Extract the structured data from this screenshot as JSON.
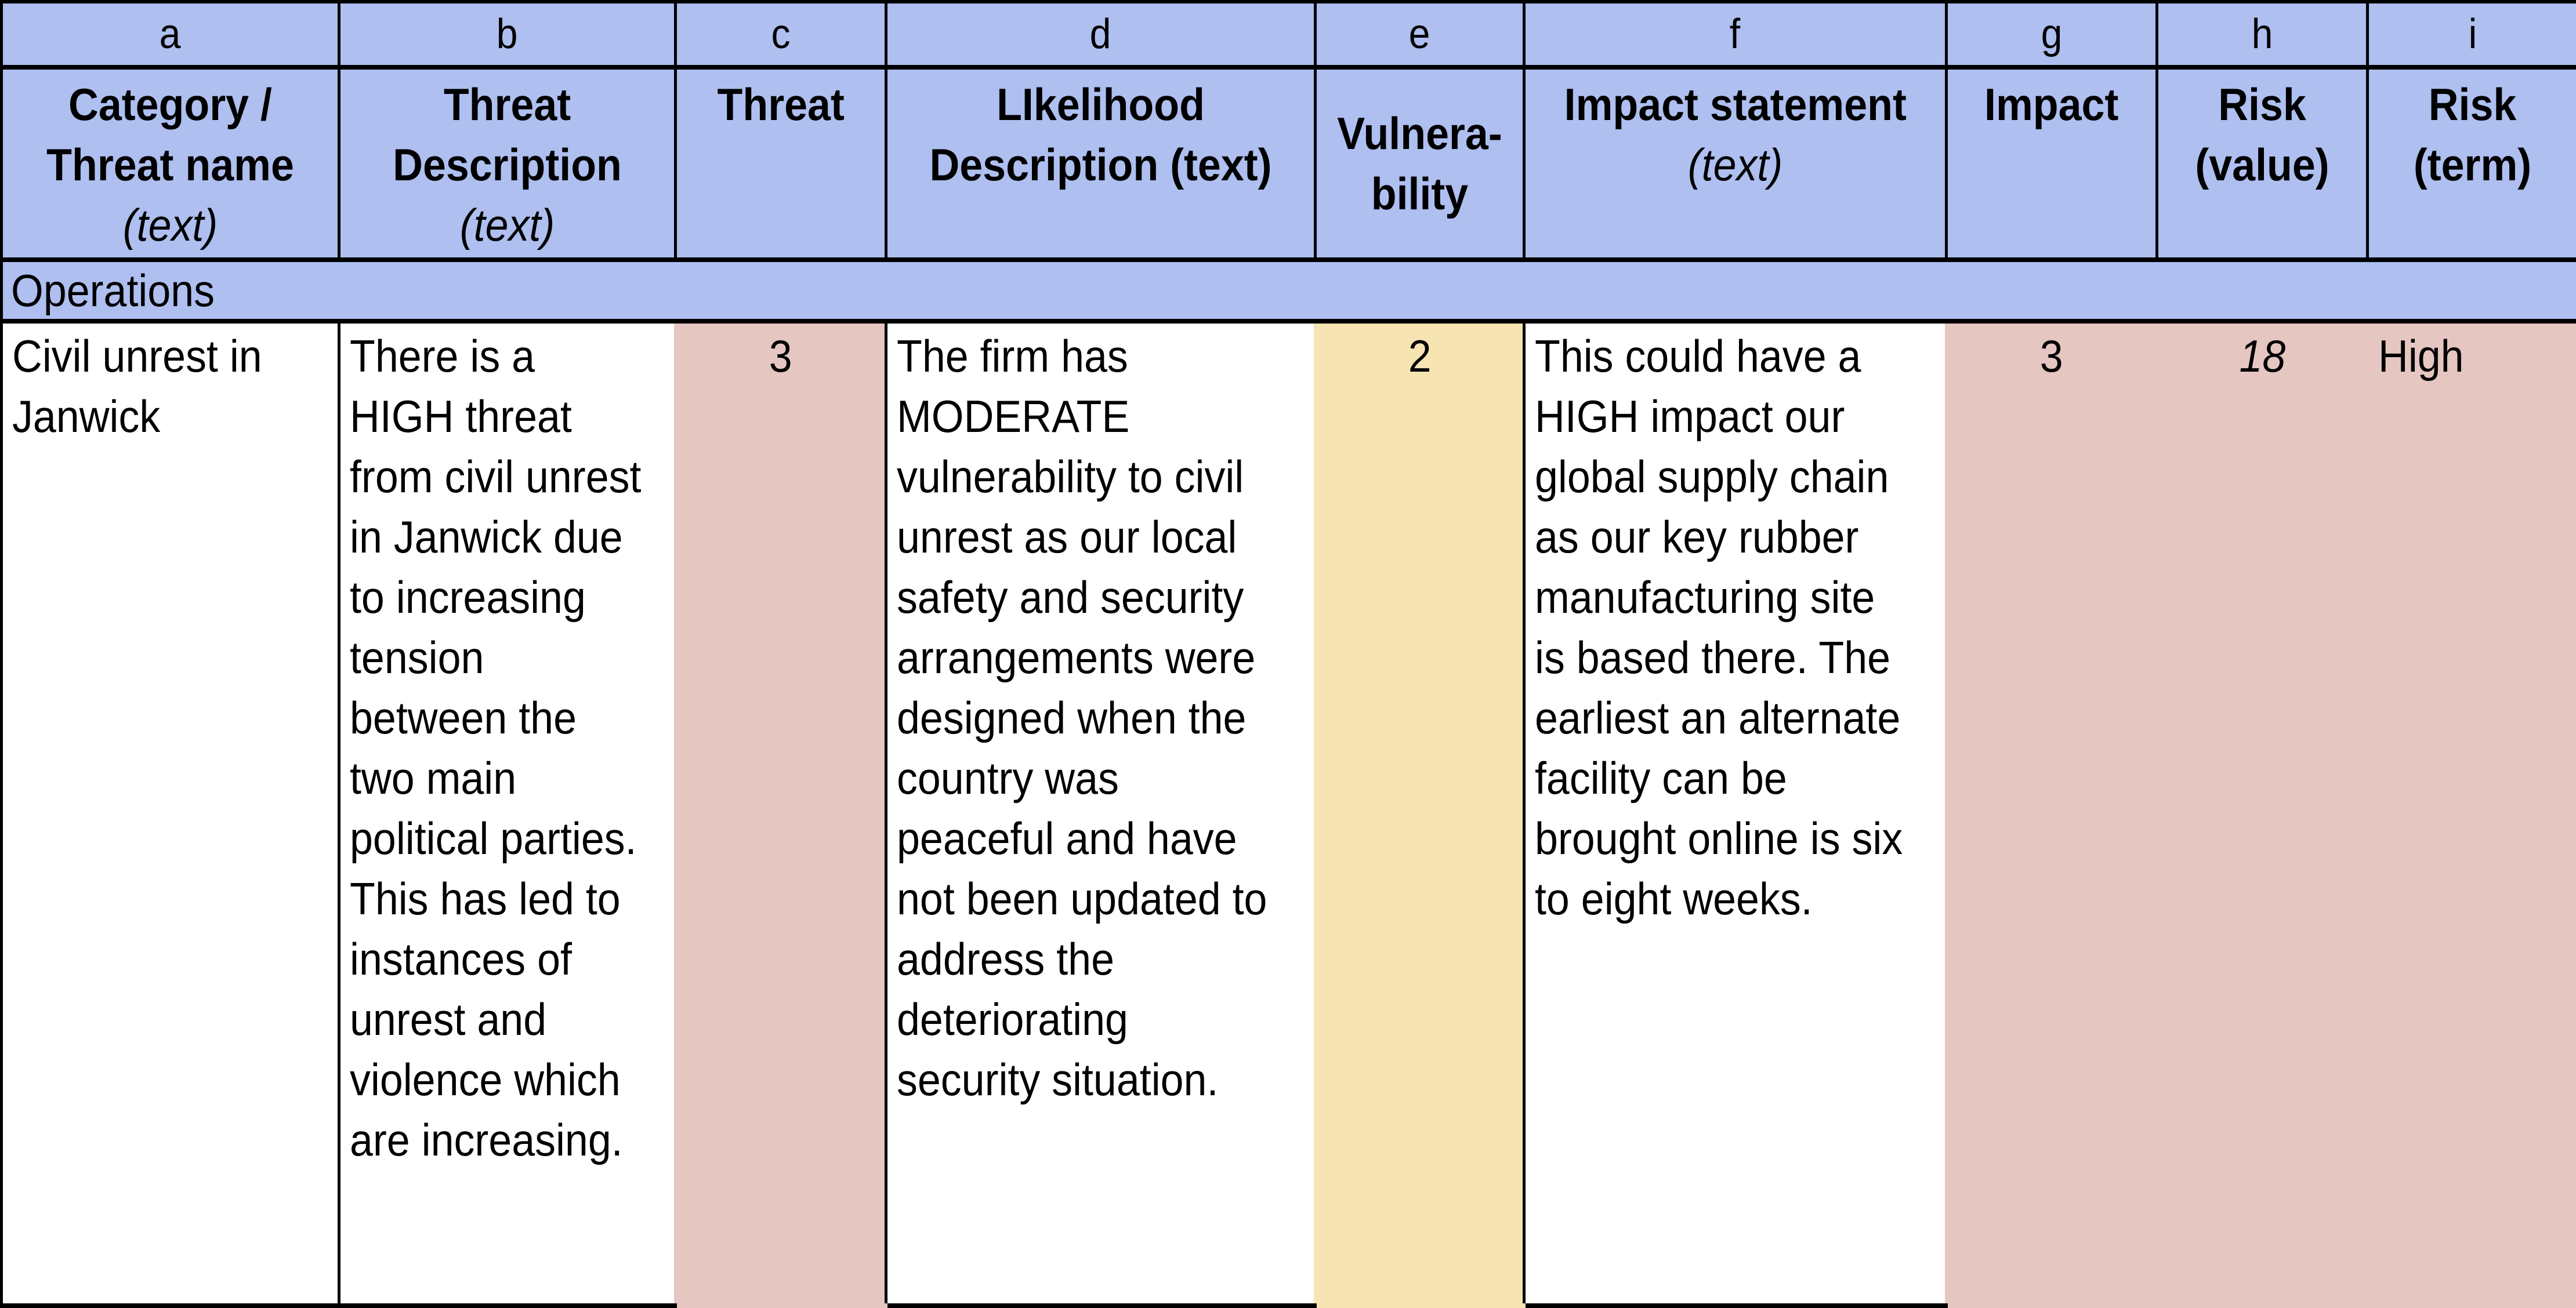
{
  "column_letters": [
    "a",
    "b",
    "c",
    "d",
    "e",
    "f",
    "g",
    "h",
    "i"
  ],
  "headers": [
    {
      "title": "Category / Threat name",
      "sub": "(text)"
    },
    {
      "title": "Threat Description",
      "sub": "(text)"
    },
    {
      "title": "Threat",
      "sub": ""
    },
    {
      "title": "LIkelihood Description (text)",
      "sub": ""
    },
    {
      "title": "Vulnera-bility",
      "sub": ""
    },
    {
      "title": "Impact statement",
      "sub": "(text)"
    },
    {
      "title": "Impact",
      "sub": ""
    },
    {
      "title": "Risk (value)",
      "sub": ""
    },
    {
      "title": "Risk (term)",
      "sub": ""
    }
  ],
  "section": {
    "label": "Operations"
  },
  "rows": [
    {
      "threat_name": "Civil unrest in Janwick",
      "threat_description": "There is a HIGH threat from civil unrest in Janwick due to increasing tension between the two main political parties.  This has led to instances of unrest and violence which are increasing.",
      "threat": "3",
      "likelihood_description": "The firm has MODERATE vulnerability to civil unrest as our local safety and security arrangements were designed when the country was peaceful and have not been updated to address the deteriorating security situation.",
      "vulnerability": "2",
      "impact_statement": "This could have a HIGH impact our global supply chain as our key rubber manufacturing site is based there. The earliest an alternate facility can be brought online is six to eight weeks.",
      "impact": "3",
      "risk_value": "18",
      "risk_term": "High"
    }
  ],
  "colors": {
    "header_fill": "#aebff0",
    "high_fill": "#e6c6c1",
    "moderate_fill": "#f6e5b2"
  }
}
